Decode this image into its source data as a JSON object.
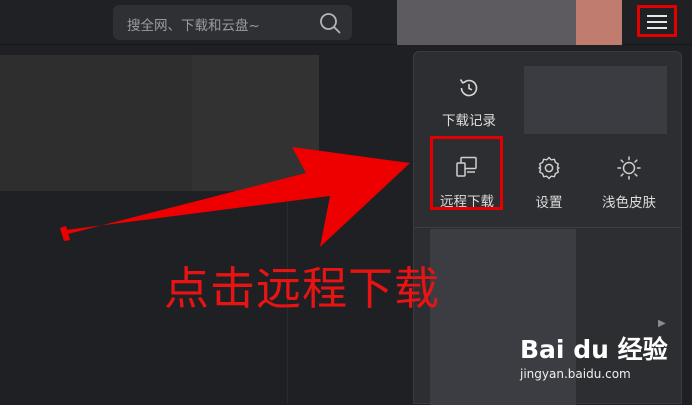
{
  "search": {
    "placeholder": "搜全网、下载和云盘~"
  },
  "menu": {
    "items": [
      {
        "label": "下载记录",
        "icon": "history-icon"
      },
      {
        "label": "远程下载",
        "icon": "remote-download-icon"
      },
      {
        "label": "设置",
        "icon": "settings-gear-icon"
      },
      {
        "label": "浅色皮肤",
        "icon": "sun-icon"
      }
    ]
  },
  "annotation": {
    "text": "点击远程下载"
  },
  "watermark": {
    "logo_text": "Bai du 经验",
    "url": "jingyan.baidu.com"
  },
  "colors": {
    "highlight": "#e40000",
    "annotation": "#e81414",
    "background": "#1f2024",
    "dropdown": "#2d2e32"
  }
}
